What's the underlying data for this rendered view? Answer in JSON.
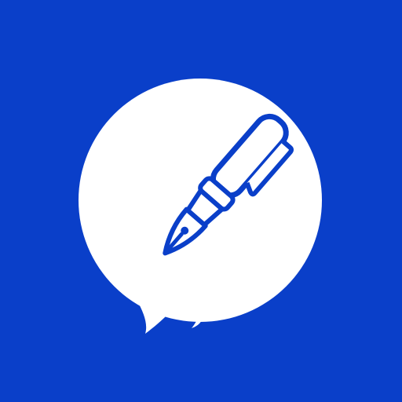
{
  "app_icon": {
    "icon_name": "fountain-pen-speech-bubble-icon",
    "colors": {
      "background": "#0a3fc9",
      "foreground": "#ffffff"
    }
  }
}
